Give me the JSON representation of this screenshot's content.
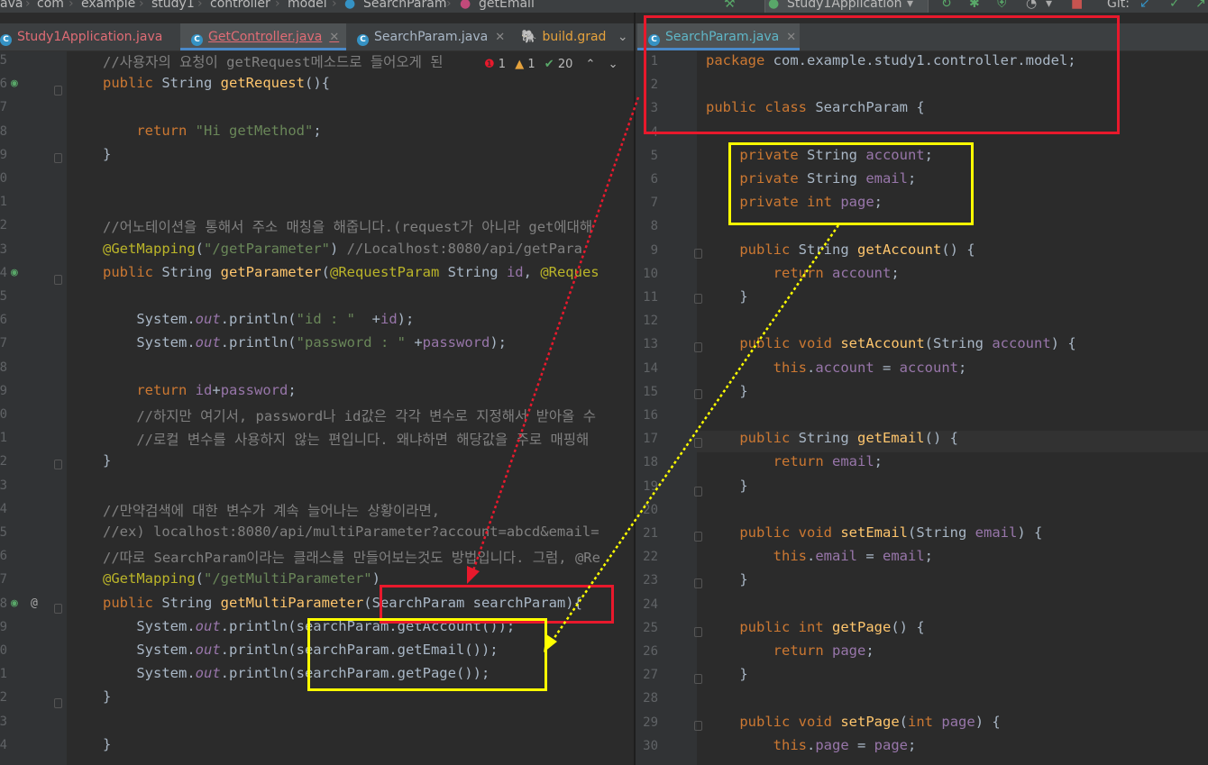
{
  "breadcrumb": [
    "ava",
    "com",
    "example",
    "study1",
    "controller",
    "model",
    "SearchParam",
    "getEmail"
  ],
  "toolbar": {
    "run_config": "Study1Application",
    "git_label": "Git:"
  },
  "left_tabs": [
    "Study1Application.java",
    "GetController.java",
    "SearchParam.java",
    "build.grad"
  ],
  "right_tab": "SearchParam.java",
  "inspections": {
    "errors": "1",
    "warnings": "1",
    "weak_warnings": "20"
  },
  "left_line_numbers": [
    "5",
    "6",
    "7",
    "8",
    "9",
    "0",
    "1",
    "2",
    "3",
    "4",
    "5",
    "6",
    "7",
    "8",
    "9",
    "0",
    "1",
    "2",
    "3",
    "4",
    "5",
    "6",
    "7",
    "8",
    "9",
    "0",
    "1",
    "2",
    "3",
    "4",
    "5",
    "6"
  ],
  "left_code": [
    "//사용자의 요청이 getRequest메소드로 들어오게 된",
    "public String getRequest(){",
    "",
    "    return \"Hi getMethod\";",
    "}",
    "",
    "",
    "//어노테이션을 통해서 주소 매칭을 해줍니다.(request가 아니라 get에대해",
    "@GetMapping(\"/getParameter\") //Localhost:8080/api/getPara",
    "public String getParameter(@RequestParam String id, @Reques",
    "",
    "    System.out.println(\"id : \"  +id);",
    "    System.out.println(\"password : \" +password);",
    "",
    "    return id+password;",
    "    //하지만 여기서, password나 id값은 각각 변수로 지정해서 받아올 수",
    "    //로컬 변수를 사용하지 않는 편입니다. 왜냐하면 해당값을 주로 매핑해",
    "}",
    "",
    "//만약검색에 대한 변수가 계속 늘어나는 상황이라면,",
    "//ex) localhost:8080/api/multiParameter?account=abcd&email=",
    "//따로 SearchParam이라는 클래스를 만들어보는것도 방법입니다. 그럼, @Re",
    "@GetMapping(\"/getMultiParameter\")",
    "public String getMultiParameter(SearchParam searchParam){",
    "    System.out.println(searchParam.getAccount());",
    "    System.out.println(searchParam.getEmail());",
    "    System.out.println(searchParam.getPage());",
    "}",
    "",
    "}"
  ],
  "right_line_numbers": [
    "1",
    "2",
    "3",
    "4",
    "5",
    "6",
    "7",
    "8",
    "9",
    "10",
    "11",
    "12",
    "13",
    "14",
    "15",
    "16",
    "17",
    "18",
    "19",
    "20",
    "21",
    "22",
    "23",
    "24",
    "25",
    "26",
    "27",
    "28",
    "29",
    "30"
  ],
  "right_code": [
    "package com.example.study1.controller.model;",
    "",
    "public class SearchParam {",
    "",
    "    private String account;",
    "    private String email;",
    "    private int page;",
    "",
    "    public String getAccount() {",
    "        return account;",
    "    }",
    "",
    "    public void setAccount(String account) {",
    "        this.account = account;",
    "    }",
    "",
    "    public String getEmail() {",
    "        return email;",
    "    }",
    "",
    "    public void setEmail(String email) {",
    "        this.email = email;",
    "    }",
    "",
    "    public int getPage() {",
    "        return page;",
    "    }",
    "",
    "    public void setPage(int page) {",
    "        this.page = page;"
  ],
  "colors": {
    "red_box": "#e8192c",
    "yellow_box": "#ffff00",
    "background": "#2b2b2b"
  }
}
